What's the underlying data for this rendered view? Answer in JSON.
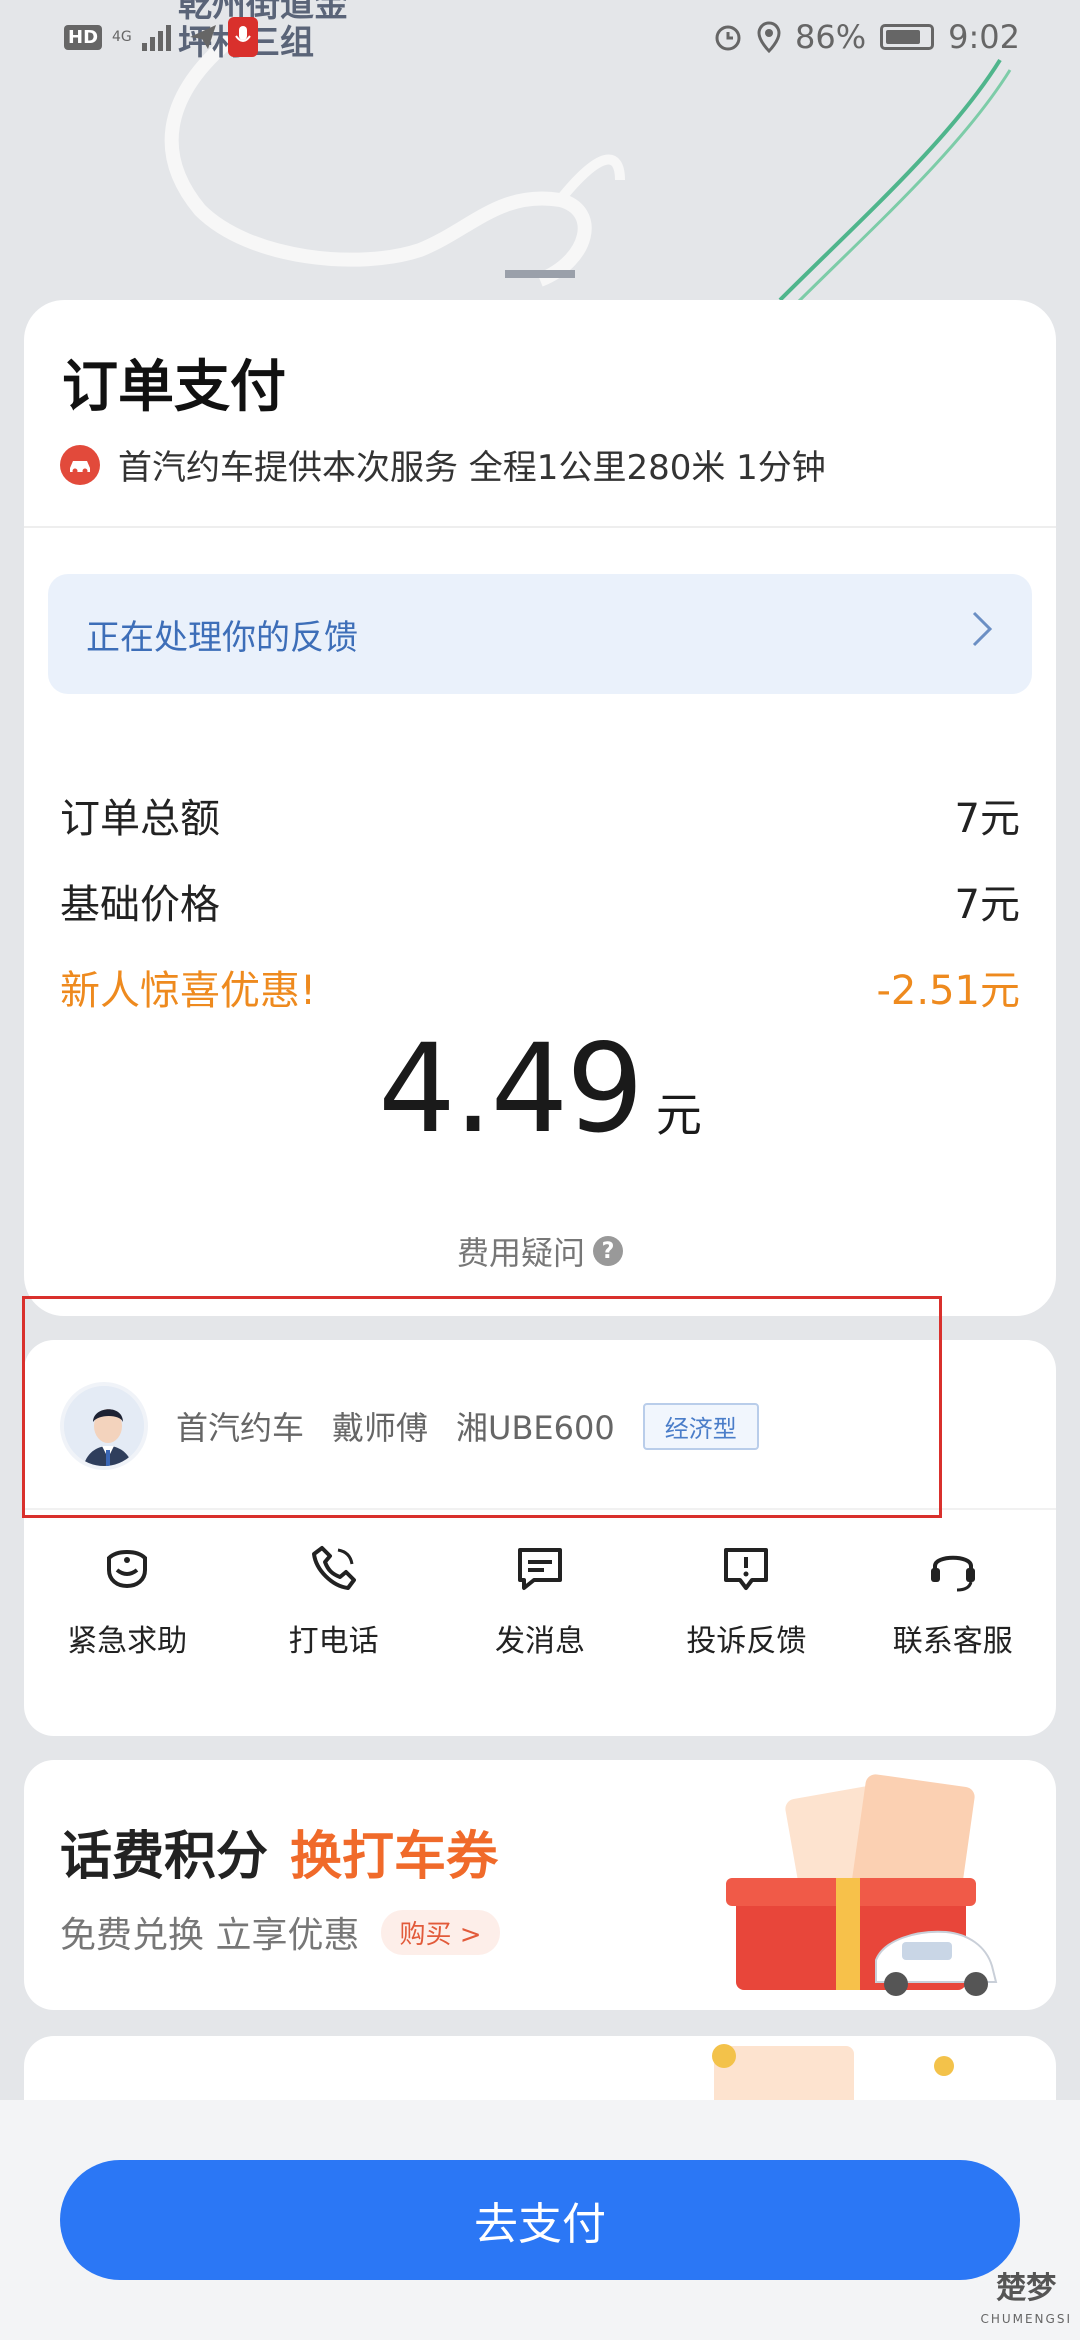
{
  "map": {
    "label_line1": "乾州街道金",
    "label_line2": "坪村三组"
  },
  "status_bar": {
    "network_badge": "HD",
    "network_type": "4G",
    "battery_percent": "86%",
    "time": "9:02"
  },
  "order": {
    "title": "订单支付",
    "service_text": "首汽约车提供本次服务 全程1公里280米 1分钟",
    "feedback_text": "正在处理你的反馈",
    "rows": [
      {
        "label": "订单总额",
        "value": "7元"
      },
      {
        "label": "基础价格",
        "value": "7元"
      },
      {
        "label": "新人惊喜优惠!",
        "value": "-2.51元"
      }
    ],
    "total_amount": "4.49",
    "total_unit": "元",
    "fee_question": "费用疑问",
    "help_glyph": "?"
  },
  "driver": {
    "company": "首汽约车",
    "name": "戴师傅",
    "plate": "湘UBE600",
    "car_type": "经济型"
  },
  "actions": [
    {
      "label": "紧急求助",
      "icon": "shield-icon"
    },
    {
      "label": "打电话",
      "icon": "phone-icon"
    },
    {
      "label": "发消息",
      "icon": "message-icon"
    },
    {
      "label": "投诉反馈",
      "icon": "complaint-icon"
    },
    {
      "label": "联系客服",
      "icon": "headset-icon"
    }
  ],
  "promo": {
    "title": "话费积分",
    "title_accent": "换打车券",
    "subtitle": "免费兑换 立享优惠",
    "buy_label": "购买 >"
  },
  "pay_button": "去支付",
  "watermark": {
    "text": "楚梦",
    "sub": "CHUMENGSI"
  },
  "colors": {
    "accent_blue": "#2b77f5",
    "discount_orange": "#ee8a1e",
    "promo_orange": "#f06a2a",
    "highlight_red": "#d9302c"
  }
}
